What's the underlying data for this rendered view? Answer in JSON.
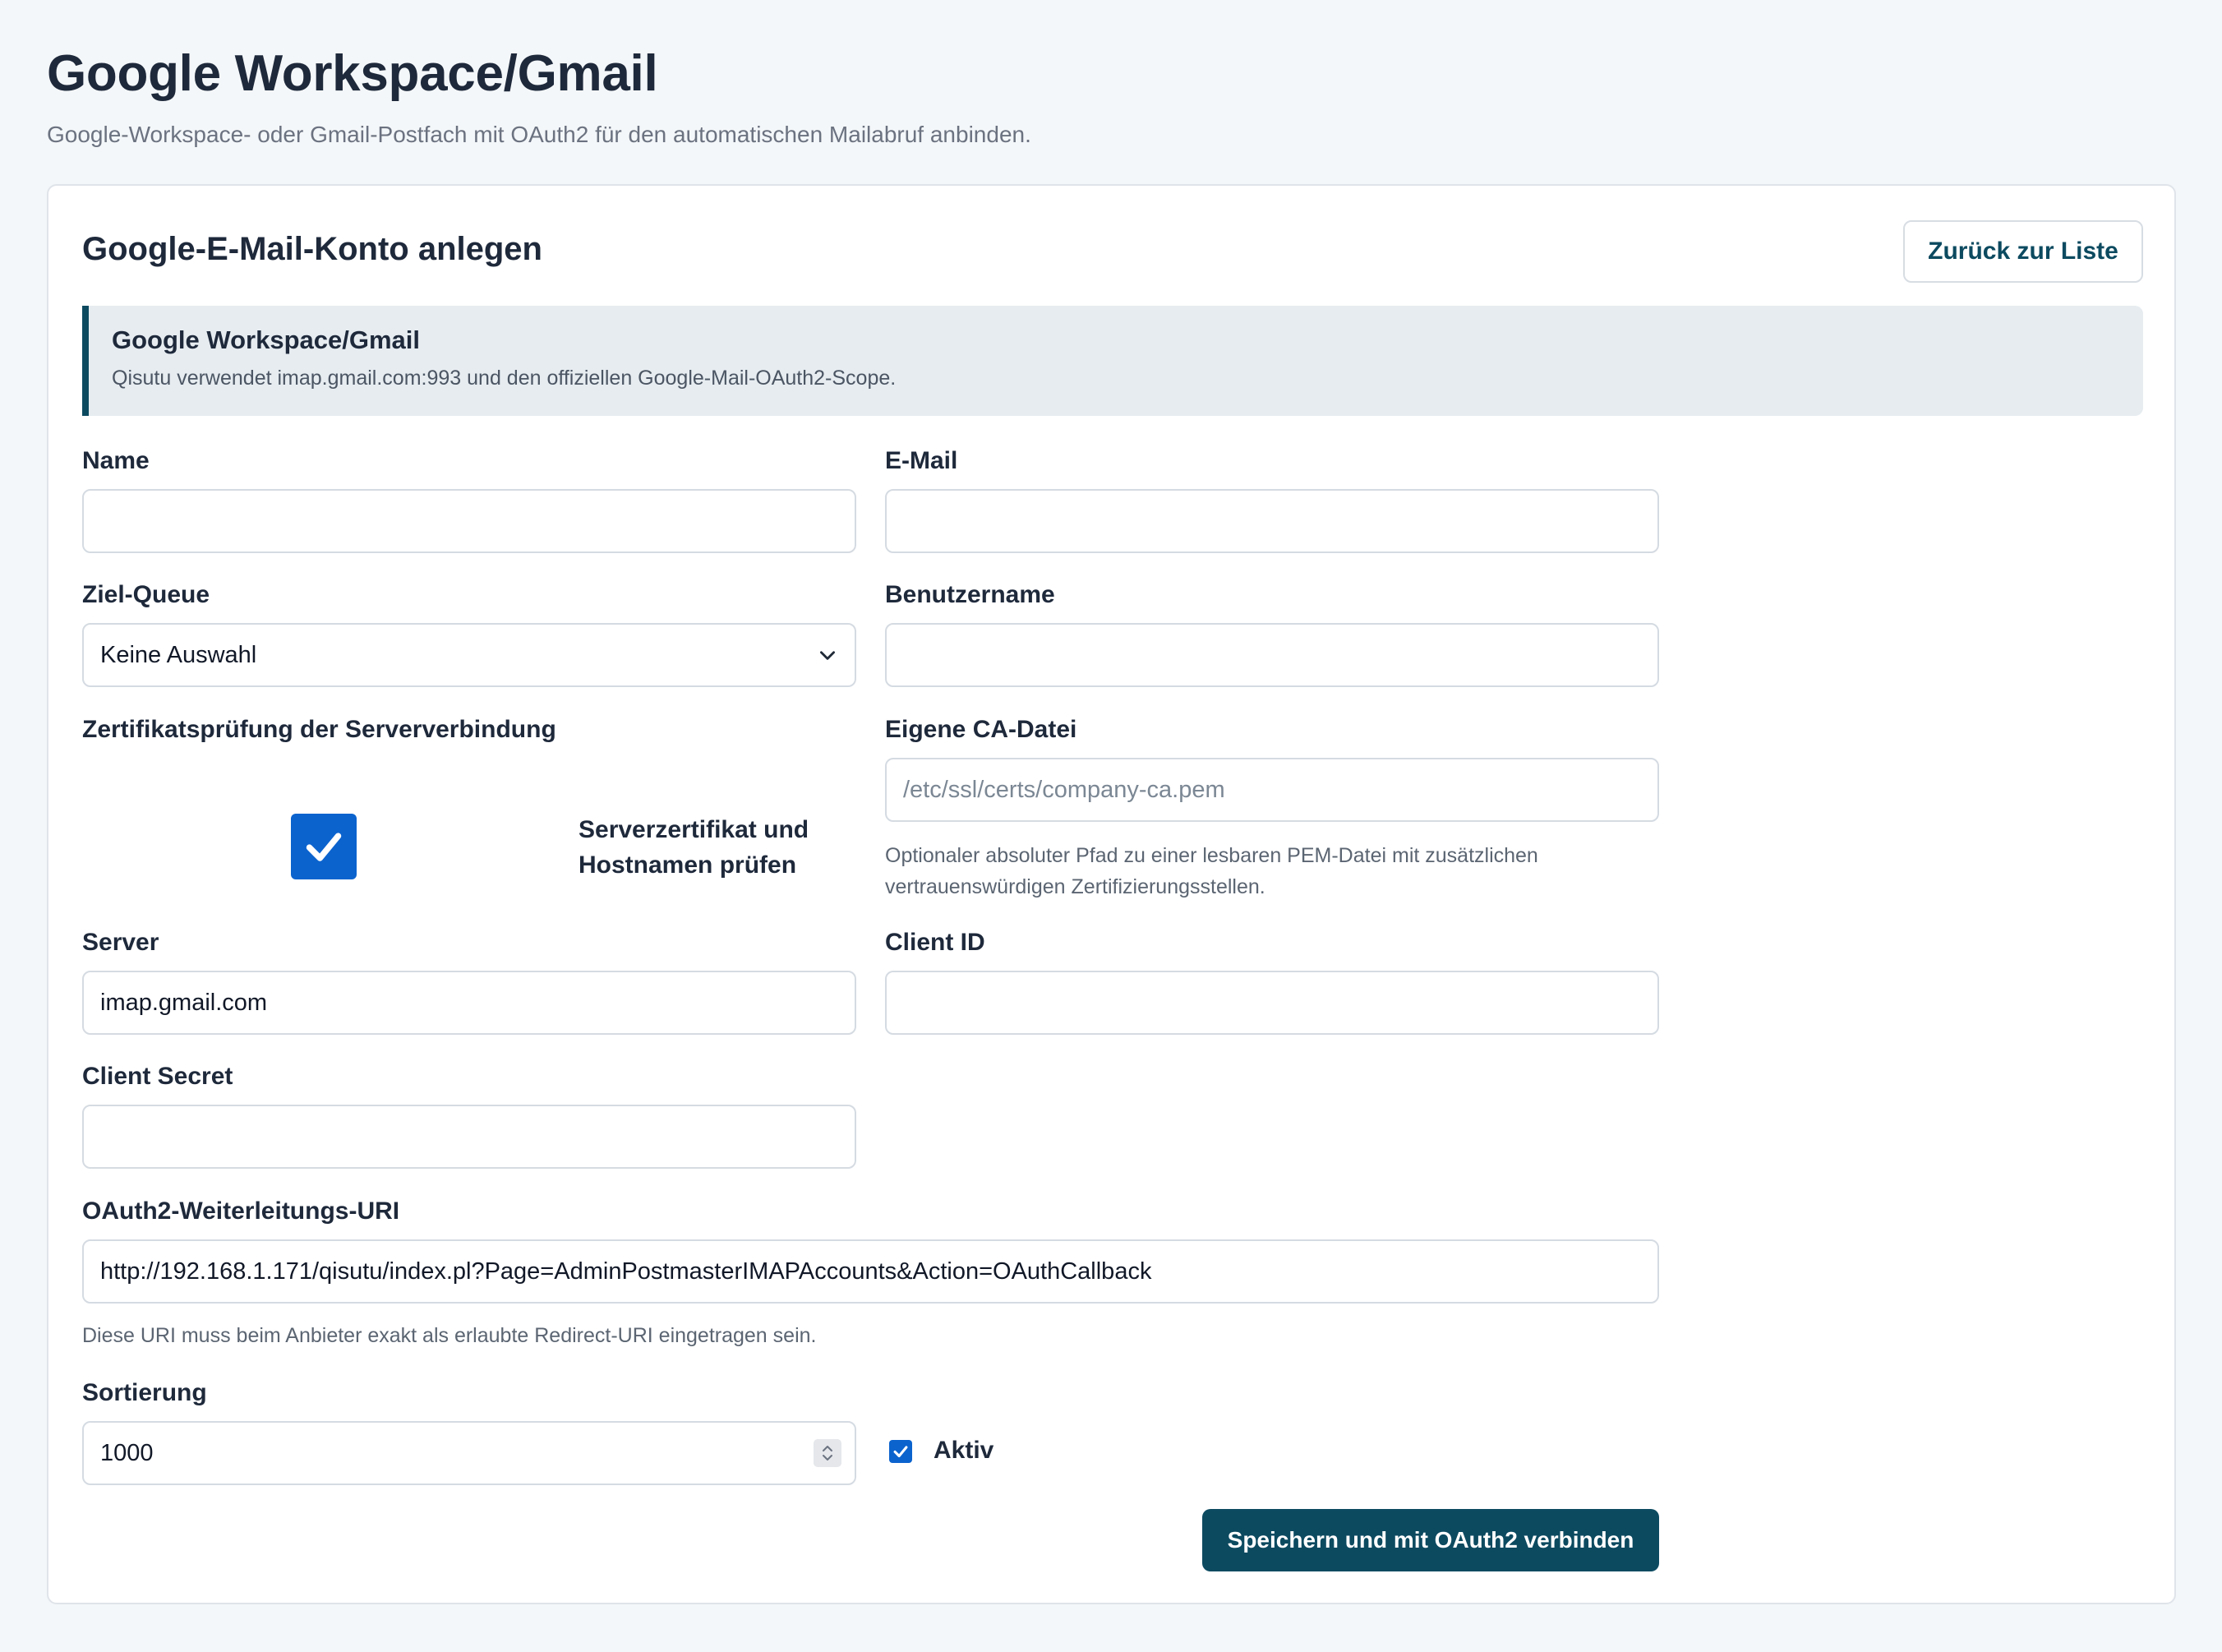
{
  "page": {
    "title": "Google Workspace/Gmail",
    "subtitle": "Google-Workspace- oder Gmail-Postfach mit OAuth2 für den automatischen Mailabruf anbinden."
  },
  "card": {
    "title": "Google-E-Mail-Konto anlegen",
    "back_label": "Zurück zur Liste"
  },
  "info": {
    "title": "Google Workspace/Gmail",
    "text": "Qisutu verwendet imap.gmail.com:993 und den offiziellen Google-Mail-OAuth2-Scope."
  },
  "form": {
    "name": {
      "label": "Name",
      "value": ""
    },
    "email": {
      "label": "E-Mail",
      "value": ""
    },
    "queue": {
      "label": "Ziel-Queue",
      "selected": "Keine Auswahl"
    },
    "username": {
      "label": "Benutzername",
      "value": ""
    },
    "cert_check": {
      "label": "Zertifikatsprüfung der Serververbindung",
      "checkbox_label": "Serverzertifikat und Hostnamen prüfen",
      "checked": true
    },
    "ca_file": {
      "label": "Eigene CA-Datei",
      "placeholder": "/etc/ssl/certs/company-ca.pem",
      "help": "Optionaler absoluter Pfad zu einer lesbaren PEM-Datei mit zusätzlichen vertrauenswürdigen Zertifizierungsstellen."
    },
    "server": {
      "label": "Server",
      "value": "imap.gmail.com"
    },
    "client_id": {
      "label": "Client ID",
      "value": ""
    },
    "client_secret": {
      "label": "Client Secret",
      "value": ""
    },
    "redirect_uri": {
      "label": "OAuth2-Weiterleitungs-URI",
      "value": "http://192.168.1.171/qisutu/index.pl?Page=AdminPostmasterIMAPAccounts&Action=OAuthCallback",
      "help": "Diese URI muss beim Anbieter exakt als erlaubte Redirect-URI eingetragen sein."
    },
    "sort": {
      "label": "Sortierung",
      "value": "1000"
    },
    "active": {
      "label": "Aktiv",
      "checked": true
    },
    "submit_label": "Speichern und mit OAuth2 verbinden"
  },
  "colors": {
    "primary": "#0c4a60",
    "checkbox": "#0b63ce",
    "background": "#f4f7f9"
  }
}
